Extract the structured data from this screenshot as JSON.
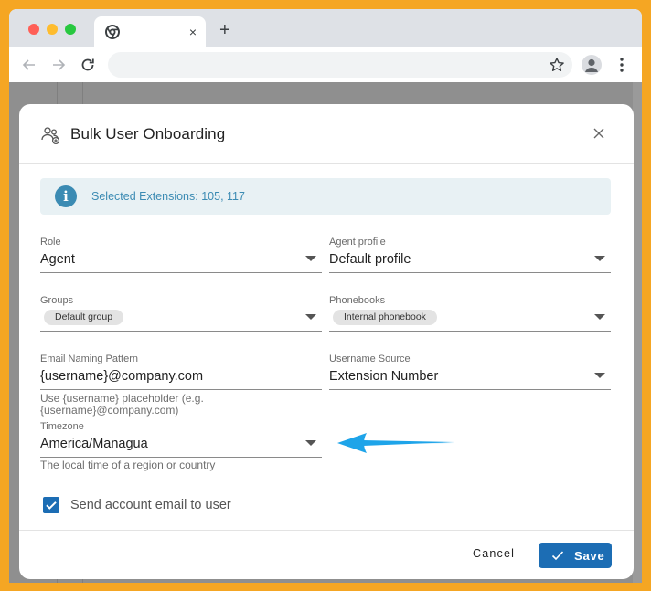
{
  "browser": {
    "tab_close": "×",
    "new_tab": "+"
  },
  "modal": {
    "title": "Bulk User Onboarding",
    "info": "Selected Extensions: 105, 117",
    "fields": {
      "role": {
        "label": "Role",
        "value": "Agent"
      },
      "agent_profile": {
        "label": "Agent profile",
        "value": "Default profile"
      },
      "groups": {
        "label": "Groups",
        "chip": "Default group"
      },
      "phonebooks": {
        "label": "Phonebooks",
        "chip": "Internal phonebook"
      },
      "email_pattern": {
        "label": "Email Naming Pattern",
        "value": "{username}@company.com",
        "helper": "Use {username} placeholder (e.g. {username}@company.com)"
      },
      "username_source": {
        "label": "Username Source",
        "value": "Extension Number"
      },
      "timezone": {
        "label": "Timezone",
        "value": "America/Managua",
        "helper": "The local time of a region or country"
      }
    },
    "send_email": {
      "label": "Send account email to user",
      "checked": true
    },
    "footer": {
      "cancel": "Cancel",
      "save": "Save"
    }
  },
  "colors": {
    "primary": "#1c6db4",
    "info": "#3b8bb3",
    "info_bg": "#e8f1f4",
    "arrow": "#1ea4e9",
    "frame": "#f5a623"
  },
  "icons": [
    "chrome-icon",
    "back-arrow-icon",
    "forward-arrow-icon",
    "reload-icon",
    "star-icon",
    "profile-icon",
    "menu-dots-icon",
    "users-icon",
    "close-icon",
    "info-icon",
    "checkmark-icon"
  ]
}
